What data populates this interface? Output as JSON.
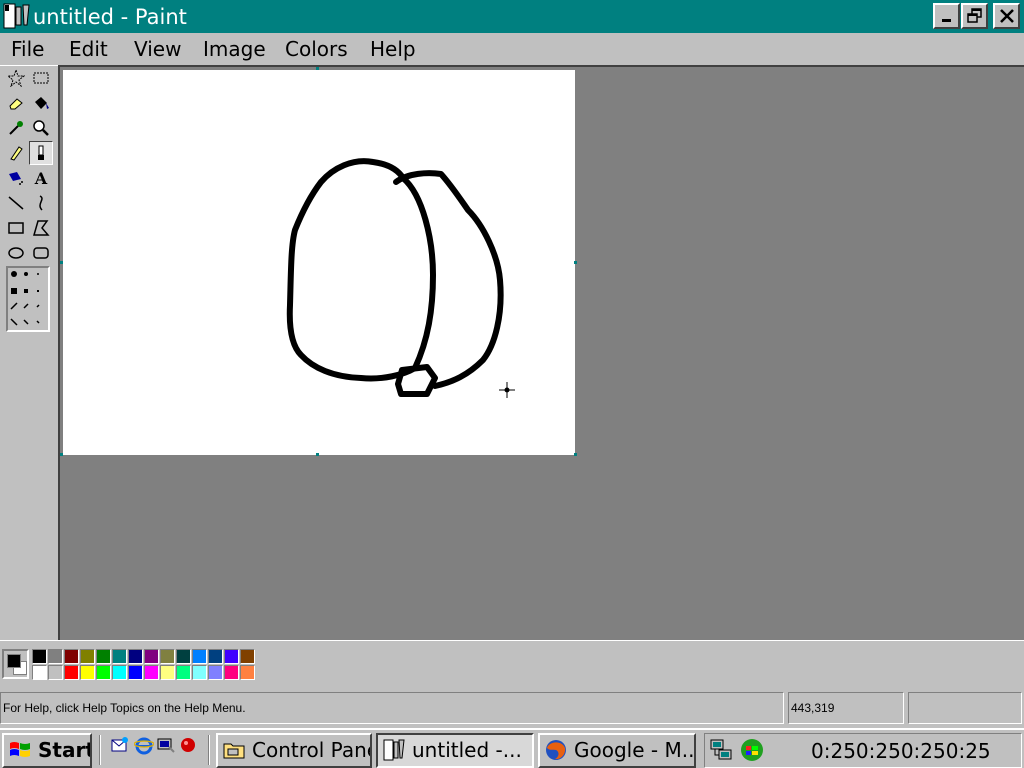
{
  "window": {
    "title": "untitled - Paint",
    "app_icon": "paint-icon",
    "controls": {
      "minimize": "minimize-icon",
      "maximize": "restore-icon",
      "close": "close-icon"
    }
  },
  "menu": [
    "File",
    "Edit",
    "View",
    "Image",
    "Colors",
    "Help"
  ],
  "toolbox": {
    "tools": [
      {
        "name": "free-form-select",
        "icon": "star-select-icon"
      },
      {
        "name": "select",
        "icon": "rect-select-icon"
      },
      {
        "name": "eraser",
        "icon": "eraser-icon"
      },
      {
        "name": "fill-with-color",
        "icon": "paint-bucket-icon"
      },
      {
        "name": "pick-color",
        "icon": "eyedropper-icon"
      },
      {
        "name": "magnifier",
        "icon": "magnifier-icon"
      },
      {
        "name": "pencil",
        "icon": "pencil-icon"
      },
      {
        "name": "brush",
        "icon": "brush-icon",
        "selected": true
      },
      {
        "name": "airbrush",
        "icon": "airbrush-icon"
      },
      {
        "name": "text",
        "icon": "text-icon",
        "label": "A"
      },
      {
        "name": "line",
        "icon": "line-icon"
      },
      {
        "name": "curve",
        "icon": "curve-icon"
      },
      {
        "name": "rectangle",
        "icon": "rectangle-icon"
      },
      {
        "name": "polygon",
        "icon": "polygon-icon"
      },
      {
        "name": "ellipse",
        "icon": "ellipse-icon"
      },
      {
        "name": "rounded-rectangle",
        "icon": "rounded-rect-icon"
      }
    ]
  },
  "palette": {
    "foreground": "#000000",
    "background": "#ffffff",
    "colors_top": [
      "#000000",
      "#808080",
      "#800000",
      "#808000",
      "#008000",
      "#008080",
      "#000080",
      "#800080",
      "#808040",
      "#004040",
      "#0080ff",
      "#004080",
      "#4000ff",
      "#804000"
    ],
    "colors_bottom": [
      "#ffffff",
      "#c0c0c0",
      "#ff0000",
      "#ffff00",
      "#00ff00",
      "#00ffff",
      "#0000ff",
      "#ff00ff",
      "#ffff80",
      "#00ff80",
      "#80ffff",
      "#8080ff",
      "#ff0080",
      "#ff8040"
    ]
  },
  "status": {
    "help_text": "For Help, click Help Topics on the Help Menu.",
    "coordinates": "443,319",
    "size": ""
  },
  "taskbar": {
    "start_label": "Start",
    "quick_launch": [
      "outlook-express-icon",
      "internet-explorer-icon",
      "show-desktop-icon",
      "channels-icon"
    ],
    "tasks": [
      {
        "label": "Control Panel",
        "icon": "folder-icon",
        "active": false
      },
      {
        "label": "untitled -...",
        "icon": "paint-icon",
        "active": true
      },
      {
        "label": "Google - M...",
        "icon": "firefox-icon",
        "active": false
      }
    ],
    "tray_icons": [
      "network-icon",
      "windows-update-icon"
    ],
    "clock": "0:250:250:250:25"
  }
}
